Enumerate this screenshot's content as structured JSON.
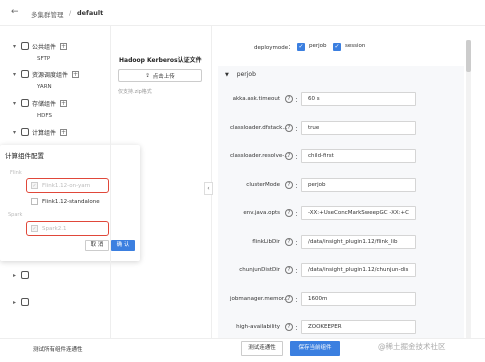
{
  "header": {
    "back_icon": "←",
    "breadcrumb_root": "多集群管理",
    "breadcrumb_sep": "/",
    "breadcrumb_current": "default"
  },
  "tree": [
    {
      "group": "公共组件",
      "arrow": "▾",
      "leaf": "SFTP"
    },
    {
      "group": "资源调度组件",
      "arrow": "▾",
      "leaf": "YARN"
    },
    {
      "group": "存储组件",
      "arrow": "▾",
      "leaf": "HDFS"
    },
    {
      "group": "计算组件",
      "arrow": "▾"
    }
  ],
  "tree_extra": {
    "arrow": "▸",
    "add_symbol": "+"
  },
  "popup": {
    "title": "计算组件配置",
    "groups": [
      {
        "name": "Flink",
        "items": [
          {
            "label": "Flink1.12-on-yarn",
            "checked": true,
            "disabled": true
          },
          {
            "label": "Flink1.12-standalone",
            "checked": false,
            "disabled": false
          }
        ]
      },
      {
        "name": "Spark",
        "items": [
          {
            "label": "Spark2.1",
            "checked": true,
            "disabled": true
          }
        ]
      }
    ],
    "cancel": "取 消",
    "ok": "确 认"
  },
  "kerberos": {
    "title": "Hadoop Kerberos认证文件",
    "upload": "点击上传",
    "hint": "仅支持.zip格式"
  },
  "deploy": {
    "label": "deploymode：",
    "options": [
      "perjob",
      "session"
    ]
  },
  "perjob": {
    "title": "perjob",
    "rows": [
      {
        "label": "akka.ask.timeout",
        "value": "60 s"
      },
      {
        "label": "classloader.dfstack...",
        "value": "true"
      },
      {
        "label": "classloader.resolve-...",
        "value": "child-first"
      },
      {
        "label": "clusterMode",
        "value": "perjob"
      },
      {
        "label": "env.java.opts",
        "value": "-XX:+UseConcMarkSweepGC -XX:+C"
      },
      {
        "label": "flinkLibDir",
        "value": "/data/insight_plugin1.12/flink_lib"
      },
      {
        "label": "chunjunDistDir",
        "value": "/data/insight_plugin1.12/chunjun-dis"
      },
      {
        "label": "jobmanager.memor...",
        "value": "1600m"
      },
      {
        "label": "high-availability",
        "value": "ZOOKEEPER"
      }
    ]
  },
  "footer": {
    "test_all": "测试所有组件连通性",
    "test": "测试连通性",
    "save": "保存当前组件",
    "watermark": "@稀土掘金技术社区"
  }
}
